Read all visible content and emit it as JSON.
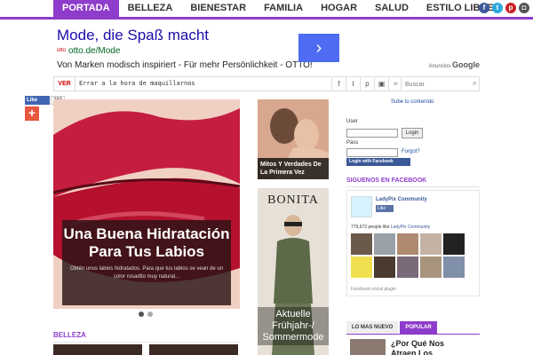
{
  "nav": {
    "items": [
      "PORTADA",
      "BELLEZA",
      "BIENESTAR",
      "FAMILIA",
      "HOGAR",
      "SALUD",
      "ESTILO LIBRE"
    ],
    "active_index": 0,
    "social": [
      {
        "icon": "facebook-icon",
        "glyph": "f",
        "color": "#3b5998"
      },
      {
        "icon": "twitter-icon",
        "glyph": "t",
        "color": "#2aa9e0"
      },
      {
        "icon": "pinterest-icon",
        "glyph": "p",
        "color": "#cb2027"
      },
      {
        "icon": "instagram-icon",
        "glyph": "◘",
        "color": "#555555"
      }
    ]
  },
  "ad": {
    "title": "Mode, die Spaß macht",
    "url": "otto.de/Mode",
    "ad_tag": "otto",
    "description": "Von Marken modisch inspiriert - Für mehr Persönlichkeit - OTTO!",
    "arrow": "›",
    "adsby_prefix": "Anuncios",
    "adsby_brand": "Google"
  },
  "ticker": {
    "label": "VER",
    "headline": "Errar a la hora de maquillarnos",
    "search_placeholder": "Buscar",
    "icons": [
      "facebook-icon",
      "twitter-icon",
      "pinterest-icon",
      "instagram-icon",
      "rss-icon"
    ]
  },
  "share": {
    "like_label": "Like",
    "like_count": "283",
    "plus": "+"
  },
  "slider": {
    "headline": "Una Buena Hidratación Para Tus Labios",
    "excerpt": "Obtén unos labios hidratados. Para que tus labios se vean de un color rosadito muy natural...",
    "active_dot": 0,
    "dot_count": 2
  },
  "sections": {
    "belleza": "BELLEZA"
  },
  "middle": {
    "card_caption": "Mitos Y Verdades De La Primera Vez",
    "ad_brand": "BONITA",
    "ad_overlay": "Aktuelle Frühjahr-/ Sommermode"
  },
  "login": {
    "subscribe": "Sube tu contenido",
    "user_label": "User",
    "pass_label": "Pass",
    "login_button": "Login",
    "forgot": "Forgot?",
    "fb_login": "Login with Facebook"
  },
  "facebook": {
    "heading": "SIGUENOS EN FACEBOOK",
    "page_name": "LadyPix Community",
    "like_label": "Like",
    "likes_count": "779,672",
    "likes_text": " people like ",
    "likes_page": "LadyPix Community",
    "plugin": "Facebook social plugin",
    "face_colors": [
      "#6a5a4a",
      "#9aa0a8",
      "#b08a70",
      "#c4b3a4",
      "#222222",
      "#f0e050",
      "#4a3a30",
      "#7a6a7a",
      "#a8947c",
      "#8090a8"
    ]
  },
  "tabs": {
    "items": [
      "LO MAS NUEVO",
      "POPULAR"
    ],
    "active_index": 1
  },
  "story": {
    "title": "¿Por Qué Nos Atraen Los"
  }
}
